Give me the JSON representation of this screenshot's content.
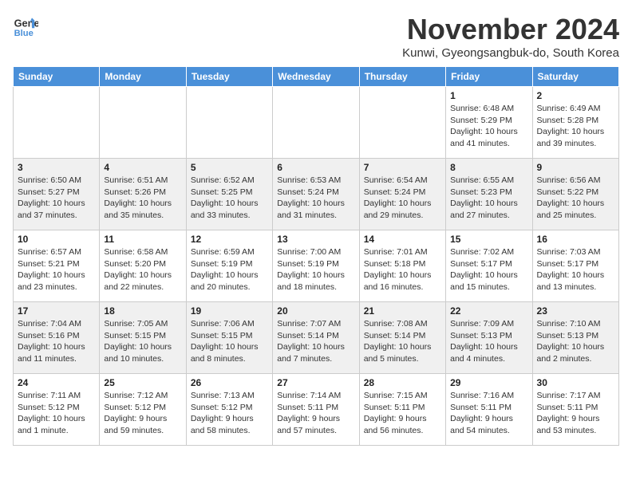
{
  "logo": {
    "line1": "General",
    "line2": "Blue"
  },
  "title": "November 2024",
  "subtitle": "Kunwi, Gyeongsangbuk-do, South Korea",
  "days_of_week": [
    "Sunday",
    "Monday",
    "Tuesday",
    "Wednesday",
    "Thursday",
    "Friday",
    "Saturday"
  ],
  "weeks": [
    [
      {
        "day": "",
        "info": ""
      },
      {
        "day": "",
        "info": ""
      },
      {
        "day": "",
        "info": ""
      },
      {
        "day": "",
        "info": ""
      },
      {
        "day": "",
        "info": ""
      },
      {
        "day": "1",
        "info": "Sunrise: 6:48 AM\nSunset: 5:29 PM\nDaylight: 10 hours and 41 minutes."
      },
      {
        "day": "2",
        "info": "Sunrise: 6:49 AM\nSunset: 5:28 PM\nDaylight: 10 hours and 39 minutes."
      }
    ],
    [
      {
        "day": "3",
        "info": "Sunrise: 6:50 AM\nSunset: 5:27 PM\nDaylight: 10 hours and 37 minutes."
      },
      {
        "day": "4",
        "info": "Sunrise: 6:51 AM\nSunset: 5:26 PM\nDaylight: 10 hours and 35 minutes."
      },
      {
        "day": "5",
        "info": "Sunrise: 6:52 AM\nSunset: 5:25 PM\nDaylight: 10 hours and 33 minutes."
      },
      {
        "day": "6",
        "info": "Sunrise: 6:53 AM\nSunset: 5:24 PM\nDaylight: 10 hours and 31 minutes."
      },
      {
        "day": "7",
        "info": "Sunrise: 6:54 AM\nSunset: 5:24 PM\nDaylight: 10 hours and 29 minutes."
      },
      {
        "day": "8",
        "info": "Sunrise: 6:55 AM\nSunset: 5:23 PM\nDaylight: 10 hours and 27 minutes."
      },
      {
        "day": "9",
        "info": "Sunrise: 6:56 AM\nSunset: 5:22 PM\nDaylight: 10 hours and 25 minutes."
      }
    ],
    [
      {
        "day": "10",
        "info": "Sunrise: 6:57 AM\nSunset: 5:21 PM\nDaylight: 10 hours and 23 minutes."
      },
      {
        "day": "11",
        "info": "Sunrise: 6:58 AM\nSunset: 5:20 PM\nDaylight: 10 hours and 22 minutes."
      },
      {
        "day": "12",
        "info": "Sunrise: 6:59 AM\nSunset: 5:19 PM\nDaylight: 10 hours and 20 minutes."
      },
      {
        "day": "13",
        "info": "Sunrise: 7:00 AM\nSunset: 5:19 PM\nDaylight: 10 hours and 18 minutes."
      },
      {
        "day": "14",
        "info": "Sunrise: 7:01 AM\nSunset: 5:18 PM\nDaylight: 10 hours and 16 minutes."
      },
      {
        "day": "15",
        "info": "Sunrise: 7:02 AM\nSunset: 5:17 PM\nDaylight: 10 hours and 15 minutes."
      },
      {
        "day": "16",
        "info": "Sunrise: 7:03 AM\nSunset: 5:17 PM\nDaylight: 10 hours and 13 minutes."
      }
    ],
    [
      {
        "day": "17",
        "info": "Sunrise: 7:04 AM\nSunset: 5:16 PM\nDaylight: 10 hours and 11 minutes."
      },
      {
        "day": "18",
        "info": "Sunrise: 7:05 AM\nSunset: 5:15 PM\nDaylight: 10 hours and 10 minutes."
      },
      {
        "day": "19",
        "info": "Sunrise: 7:06 AM\nSunset: 5:15 PM\nDaylight: 10 hours and 8 minutes."
      },
      {
        "day": "20",
        "info": "Sunrise: 7:07 AM\nSunset: 5:14 PM\nDaylight: 10 hours and 7 minutes."
      },
      {
        "day": "21",
        "info": "Sunrise: 7:08 AM\nSunset: 5:14 PM\nDaylight: 10 hours and 5 minutes."
      },
      {
        "day": "22",
        "info": "Sunrise: 7:09 AM\nSunset: 5:13 PM\nDaylight: 10 hours and 4 minutes."
      },
      {
        "day": "23",
        "info": "Sunrise: 7:10 AM\nSunset: 5:13 PM\nDaylight: 10 hours and 2 minutes."
      }
    ],
    [
      {
        "day": "24",
        "info": "Sunrise: 7:11 AM\nSunset: 5:12 PM\nDaylight: 10 hours and 1 minute."
      },
      {
        "day": "25",
        "info": "Sunrise: 7:12 AM\nSunset: 5:12 PM\nDaylight: 9 hours and 59 minutes."
      },
      {
        "day": "26",
        "info": "Sunrise: 7:13 AM\nSunset: 5:12 PM\nDaylight: 9 hours and 58 minutes."
      },
      {
        "day": "27",
        "info": "Sunrise: 7:14 AM\nSunset: 5:11 PM\nDaylight: 9 hours and 57 minutes."
      },
      {
        "day": "28",
        "info": "Sunrise: 7:15 AM\nSunset: 5:11 PM\nDaylight: 9 hours and 56 minutes."
      },
      {
        "day": "29",
        "info": "Sunrise: 7:16 AM\nSunset: 5:11 PM\nDaylight: 9 hours and 54 minutes."
      },
      {
        "day": "30",
        "info": "Sunrise: 7:17 AM\nSunset: 5:11 PM\nDaylight: 9 hours and 53 minutes."
      }
    ]
  ]
}
